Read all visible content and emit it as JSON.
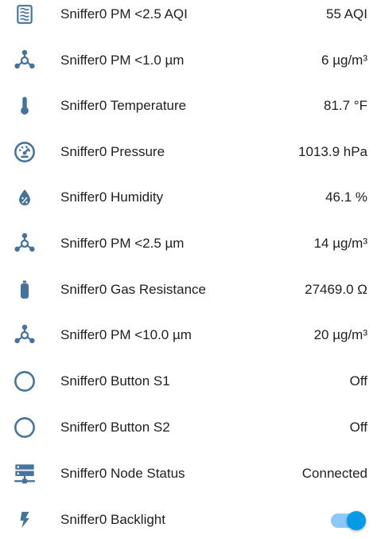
{
  "colors": {
    "icon": "#44739e",
    "text": "#212121",
    "toggle_track": "#8cc9f6",
    "toggle_knob": "#039be5"
  },
  "entities": [
    {
      "icon": "air-filter-icon",
      "name": "Sniffer0 PM <2.5 AQI",
      "state": "55 AQI"
    },
    {
      "icon": "molecule-icon",
      "name": "Sniffer0 PM <1.0 µm",
      "state": "6 µg/m³"
    },
    {
      "icon": "thermometer-icon",
      "name": "Sniffer0 Temperature",
      "state": "81.7 °F"
    },
    {
      "icon": "gauge-icon",
      "name": "Sniffer0 Pressure",
      "state": "1013.9 hPa"
    },
    {
      "icon": "water-percent-icon",
      "name": "Sniffer0 Humidity",
      "state": "46.1 %"
    },
    {
      "icon": "molecule-icon",
      "name": "Sniffer0 PM <2.5 µm",
      "state": "14 µg/m³"
    },
    {
      "icon": "gas-cylinder-icon",
      "name": "Sniffer0 Gas Resistance",
      "state": "27469.0 Ω"
    },
    {
      "icon": "molecule-icon",
      "name": "Sniffer0 PM <10.0 µm",
      "state": "20 µg/m³"
    },
    {
      "icon": "circle-outline-icon",
      "name": "Sniffer0 Button S1",
      "state": "Off"
    },
    {
      "icon": "circle-outline-icon",
      "name": "Sniffer0 Button S2",
      "state": "Off"
    },
    {
      "icon": "server-network-icon",
      "name": "Sniffer0 Node Status",
      "state": "Connected"
    },
    {
      "icon": "flash-icon",
      "name": "Sniffer0 Backlight",
      "state_on": true
    }
  ]
}
